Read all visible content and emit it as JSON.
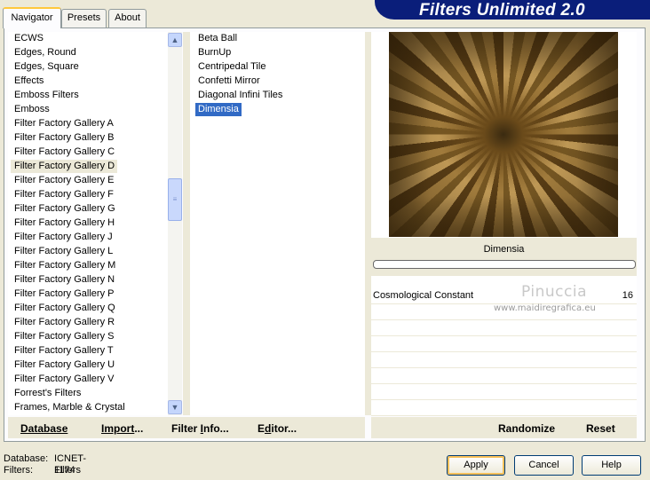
{
  "tabs": [
    {
      "label": "Navigator",
      "active": true
    },
    {
      "label": "Presets",
      "active": false
    },
    {
      "label": "About",
      "active": false
    }
  ],
  "banner": {
    "title": "Filters Unlimited 2.0"
  },
  "categories": {
    "items": [
      "ECWS",
      "Edges, Round",
      "Edges, Square",
      "Effects",
      "Emboss Filters",
      "Emboss",
      "Filter Factory Gallery A",
      "Filter Factory Gallery B",
      "Filter Factory Gallery C",
      "Filter Factory Gallery D",
      "Filter Factory Gallery E",
      "Filter Factory Gallery F",
      "Filter Factory Gallery G",
      "Filter Factory Gallery H",
      "Filter Factory Gallery J",
      "Filter Factory Gallery L",
      "Filter Factory Gallery M",
      "Filter Factory Gallery N",
      "Filter Factory Gallery P",
      "Filter Factory Gallery Q",
      "Filter Factory Gallery R",
      "Filter Factory Gallery S",
      "Filter Factory Gallery T",
      "Filter Factory Gallery U",
      "Filter Factory Gallery V",
      "Forrest's Filters",
      "Frames, Marble & Crystal"
    ],
    "selected": "Filter Factory Gallery D"
  },
  "filters": {
    "items": [
      "Beta Ball",
      "BurnUp",
      "Centripedal Tile",
      "Confetti Mirror",
      "Diagonal Infini Tiles",
      "Dimensia"
    ],
    "selected": "Dimensia"
  },
  "preview": {
    "filter_name": "Dimensia"
  },
  "parameters": [
    {
      "label": "Cosmological Constant",
      "value": "16"
    }
  ],
  "watermark": {
    "name": "Pinuccia",
    "url": "www.maidiregrafica.eu"
  },
  "left_buttons": {
    "database": "Database",
    "import_pre": "Import",
    "import_post": "...",
    "filter_info_pre": "Filter ",
    "filter_info_u": "I",
    "filter_info_post": "nfo...",
    "editor_pre": "E",
    "editor_u": "d",
    "editor_post": "itor..."
  },
  "right_buttons": {
    "randomize": "Randomize",
    "reset": "Reset"
  },
  "status": {
    "database_label": "Database:",
    "database_value": "ICNET-Filters",
    "filters_label": "Filters:",
    "filters_value": "1174"
  },
  "dialog_buttons": {
    "apply": "Apply",
    "cancel": "Cancel",
    "help": "Help"
  },
  "colors": {
    "selection": "#316ac5",
    "banner": "#0a1e7a",
    "dialog_bg": "#ece9d8"
  }
}
